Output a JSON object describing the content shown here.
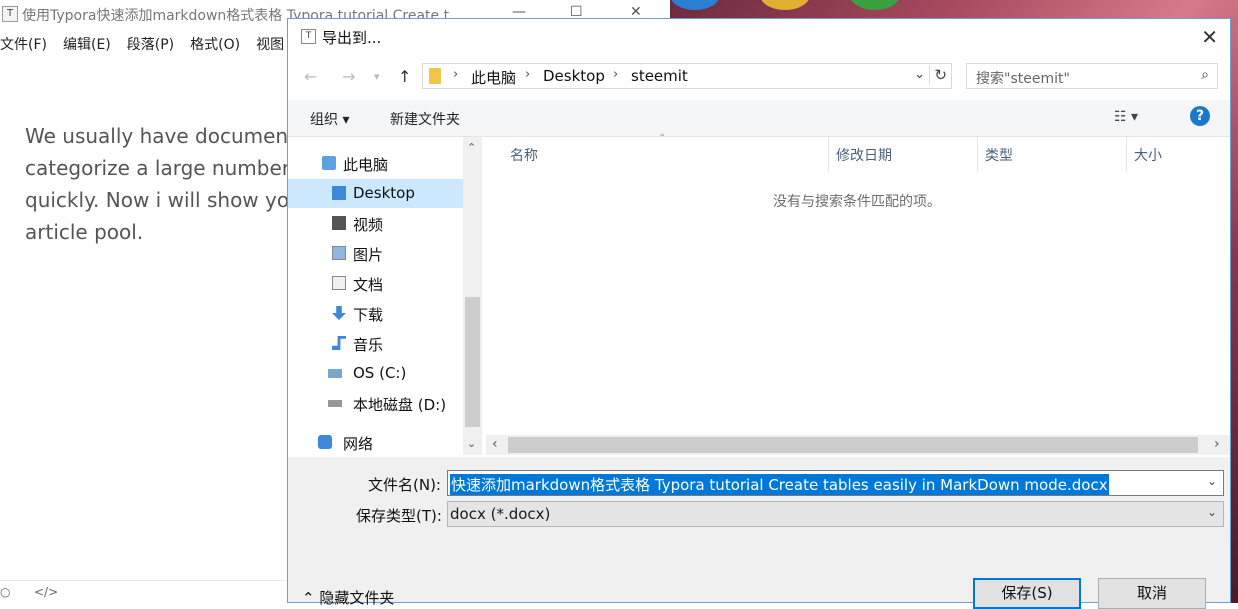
{
  "typora": {
    "window_title": "使用Typora快速添加markdown格式表格 Typora tutorial Create t",
    "menu": [
      "文件(F)",
      "编辑(E)",
      "段落(P)",
      "格式(O)",
      "视图"
    ],
    "content_lines": [
      "We usually have documents",
      "categorize a large number o",
      "quickly. Now i will show you",
      "article pool."
    ],
    "status_left": "○",
    "status_code": "</>"
  },
  "dialog": {
    "title": "导出到...",
    "address": {
      "crumbs": [
        "此电脑",
        "Desktop",
        "steemit"
      ]
    },
    "search": {
      "placeholder": "搜索\"steemit\""
    },
    "toolbar": {
      "organize": "组织 ▾",
      "new_folder": "新建文件夹"
    },
    "nav_items": [
      {
        "label": "此电脑",
        "icon": "computer-icon"
      },
      {
        "label": "Desktop",
        "icon": "desktop-folder-icon"
      },
      {
        "label": "视频",
        "icon": "video-folder-icon"
      },
      {
        "label": "图片",
        "icon": "pictures-folder-icon"
      },
      {
        "label": "文档",
        "icon": "documents-folder-icon"
      },
      {
        "label": "下载",
        "icon": "downloads-folder-icon"
      },
      {
        "label": "音乐",
        "icon": "music-folder-icon"
      },
      {
        "label": "OS (C:)",
        "icon": "drive-c-icon"
      },
      {
        "label": "本地磁盘 (D:)",
        "icon": "drive-d-icon"
      },
      {
        "label": "网络",
        "icon": "network-icon"
      }
    ],
    "selected_nav": "Desktop",
    "columns": [
      "名称",
      "修改日期",
      "类型",
      "大小"
    ],
    "empty_message": "没有与搜索条件匹配的项。",
    "filename_label": "文件名(N):",
    "filename_value": "快速添加markdown格式表格 Typora tutorial Create tables easily in MarkDown mode.docx",
    "filetype_label": "保存类型(T):",
    "filetype_value": "docx (*.docx)",
    "hide_folders": "隐藏文件夹",
    "save_button": "保存(S)",
    "cancel_button": "取消"
  },
  "colors": {
    "accent": "#0078d7",
    "selection": "#cce8ff",
    "help": "#1979ca"
  }
}
